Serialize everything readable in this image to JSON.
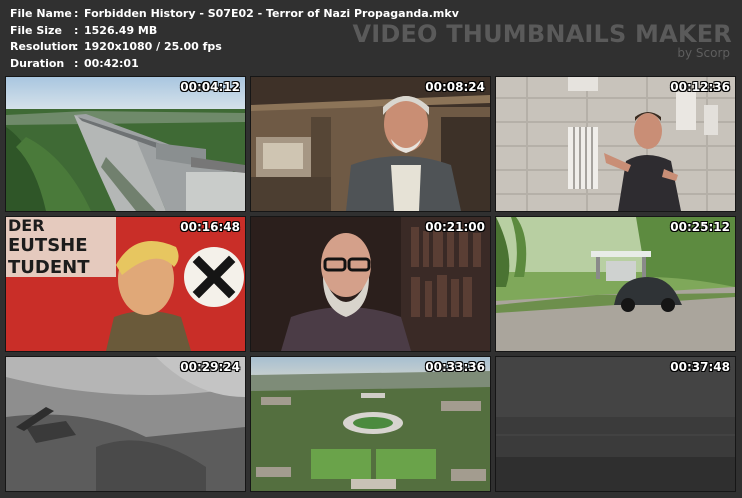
{
  "file_info": {
    "file_name": {
      "label": "File Name",
      "value": "Forbidden History - S07E02 - Terror of Nazi Propaganda.mkv"
    },
    "file_size": {
      "label": "File Size",
      "value": "1526.49 MB"
    },
    "resolution": {
      "label": "Resolution",
      "value": "1920x1080 / 25.00 fps"
    },
    "duration": {
      "label": "Duration",
      "value": "00:42:01"
    }
  },
  "watermark": {
    "title": "VIDEO THUMBNAILS MAKER",
    "subtitle": "by Scorp"
  },
  "poster_text": {
    "line1": "DER",
    "line2": "EUTSHE",
    "line3": "TUDENT"
  },
  "thumbnails": [
    {
      "timestamp": "00:04:12"
    },
    {
      "timestamp": "00:08:24"
    },
    {
      "timestamp": "00:12:36"
    },
    {
      "timestamp": "00:16:48"
    },
    {
      "timestamp": "00:21:00"
    },
    {
      "timestamp": "00:25:12"
    },
    {
      "timestamp": "00:29:24"
    },
    {
      "timestamp": "00:33:36"
    },
    {
      "timestamp": "00:37:48"
    }
  ]
}
